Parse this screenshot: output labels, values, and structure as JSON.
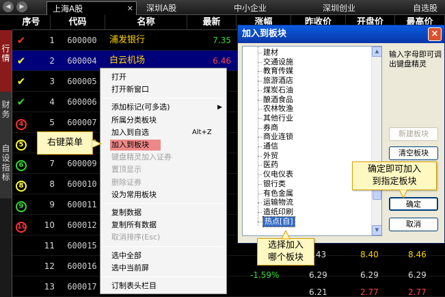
{
  "tabs": [
    {
      "label": "上海A股",
      "active": true
    },
    {
      "label": "深圳A股"
    },
    {
      "label": "中小企业"
    },
    {
      "label": "深圳创业"
    },
    {
      "label": "自选股"
    }
  ],
  "side_tabs": [
    {
      "label": "行情",
      "active": true
    },
    {
      "label": "财务"
    },
    {
      "label": "自设指标"
    }
  ],
  "table": {
    "headers": [
      "序号",
      "代码",
      "名称",
      "最新",
      "涨幅",
      "昨收价",
      "开盘价",
      "最高价"
    ],
    "rows": [
      {
        "mark": "✔",
        "mark_color": "#ff3333",
        "index": "1",
        "code": "600000",
        "name": "浦发银行",
        "latest": "7.35",
        "latest_color": "#33dd33"
      },
      {
        "mark": "✔",
        "mark_color": "#ffff33",
        "index": "2",
        "code": "600004",
        "name": "白云机场",
        "latest": "6.46",
        "latest_color": "#ff4444",
        "selected": true
      },
      {
        "mark": "✔",
        "mark_color": "#ffff33",
        "index": "3",
        "code": "600005",
        "name": "",
        "latest": ""
      },
      {
        "mark": "✔",
        "mark_color": "#33dd33",
        "index": "4",
        "code": "600006",
        "name": "",
        "latest": ""
      },
      {
        "mark": "4",
        "mark_color": "#ff3333",
        "circle": true,
        "index": "5",
        "code": "600007",
        "name": "",
        "latest": ""
      },
      {
        "mark": "5",
        "mark_color": "#ffff33",
        "circle": true,
        "index": "6",
        "code": "600008",
        "name": "",
        "latest": ""
      },
      {
        "mark": "6",
        "mark_color": "#33dd33",
        "circle": true,
        "index": "7",
        "code": "600009",
        "name": "",
        "latest": ""
      },
      {
        "mark": "8",
        "mark_color": "#ffff33",
        "circle": true,
        "index": "8",
        "code": "600010",
        "name": "",
        "latest": ""
      },
      {
        "mark": "9",
        "mark_color": "#33dd33",
        "circle": true,
        "index": "9",
        "code": "600011",
        "name": "",
        "latest": ""
      },
      {
        "mark": "10",
        "mark_color": "#ff3333",
        "circle": true,
        "index": "10",
        "code": "600012",
        "name": "",
        "latest": ""
      },
      {
        "mark": "",
        "index": "11",
        "code": "600015",
        "name": "",
        "latest": ""
      },
      {
        "mark": "",
        "index": "12",
        "code": "600016",
        "name": "",
        "latest": ""
      },
      {
        "mark": "",
        "index": "13",
        "code": "600017",
        "name": "",
        "latest": ""
      }
    ],
    "visible_tail": [
      {
        "row": 11,
        "change": "",
        "prev_close": ".43",
        "open": "8.40",
        "high": "8.46"
      },
      {
        "row": 12,
        "change": "-1.59%",
        "prev_close": "6.29",
        "open": "6.29",
        "high": "6.29"
      },
      {
        "row": 13,
        "change": "",
        "prev_close": "6.21",
        "open": "2.77",
        "high": "2.77"
      }
    ]
  },
  "context_menu": {
    "items": [
      {
        "label": "打开"
      },
      {
        "label": "打开新窗口"
      },
      {
        "sep": true
      },
      {
        "label": "添加标记(可多选)",
        "submenu": true
      },
      {
        "label": "所属分类板块"
      },
      {
        "label": "加入到自选",
        "shortcut": "Alt+Z"
      },
      {
        "label": "加入到板块",
        "highlight": true
      },
      {
        "label": "键盘精灵加入证券",
        "disabled": true
      },
      {
        "label": "置顶显示",
        "disabled": true
      },
      {
        "label": "删除证券",
        "disabled": true
      },
      {
        "label": "设为常用板块"
      },
      {
        "sep": true
      },
      {
        "label": "复制数据"
      },
      {
        "label": "复制所有数据"
      },
      {
        "label": "取消排序(Esc)",
        "disabled": true
      },
      {
        "sep": true
      },
      {
        "label": "选中全部"
      },
      {
        "label": "选中当前屏"
      },
      {
        "sep": true
      },
      {
        "label": "订制表头栏目"
      }
    ]
  },
  "callouts": {
    "right_click": "右键菜单",
    "select_sector": [
      "选择加入",
      "哪个板块"
    ],
    "confirm": [
      "确定即可加入",
      "到指定板块"
    ]
  },
  "dialog": {
    "title": "加入到板块",
    "close_icon": "×",
    "hint": "输入字母即可调出键盘精灵",
    "tree_items": [
      "建材",
      "交通设施",
      "教育传媒",
      "旅游酒店",
      "煤炭石油",
      "酿酒食品",
      "农林牧渔",
      "其他行业",
      "券商",
      "商业连锁",
      "通信",
      "外贸",
      "医药",
      "仪电仪表",
      "银行类",
      "有色金属",
      "运输物流",
      "造纸印刷",
      "热点[自]"
    ],
    "selected_item": "热点[自]",
    "buttons": {
      "new_sector": "新建板块",
      "clear_sector": "清空板块",
      "ok": "确定",
      "cancel": "取消"
    }
  },
  "colors": {
    "tab_bar": "#2a2a2a",
    "selected_row": "#00007a",
    "stock_name": "#ffd700",
    "dialog_title": "#0a5ce0"
  }
}
